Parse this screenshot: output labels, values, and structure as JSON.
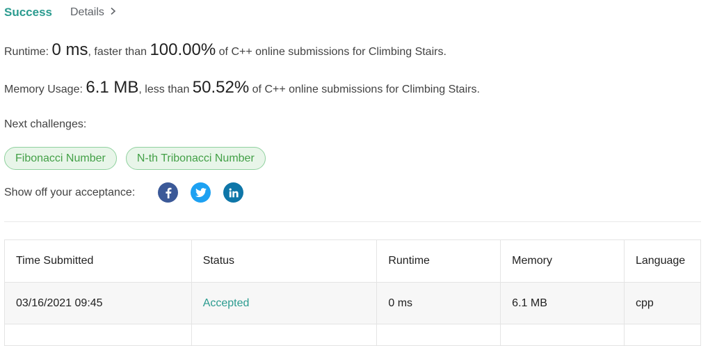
{
  "header": {
    "success_label": "Success",
    "details_label": "Details",
    "details_chevron": "chevron-right-icon"
  },
  "runtime": {
    "label": "Runtime:",
    "value": "0 ms",
    "middle": ", faster than",
    "percent": "100.00%",
    "suffix": "of C++ online submissions for Climbing Stairs."
  },
  "memory": {
    "label": "Memory Usage:",
    "value": "6.1 MB",
    "middle": ", less than",
    "percent": "50.52%",
    "suffix": "of C++ online submissions for Climbing Stairs."
  },
  "next_challenges": {
    "label": "Next challenges:",
    "items": [
      "Fibonacci Number",
      "N-th Tribonacci Number"
    ]
  },
  "share": {
    "label": "Show off your acceptance:",
    "icons": [
      "facebook-icon",
      "twitter-icon",
      "linkedin-icon"
    ]
  },
  "table": {
    "columns": [
      "Time Submitted",
      "Status",
      "Runtime",
      "Memory",
      "Language"
    ],
    "rows": [
      [
        "03/16/2021 09:45",
        "Accepted",
        "0 ms",
        "6.1 MB",
        "cpp"
      ]
    ]
  },
  "colors": {
    "success": "#2b9b8f",
    "chip_border": "#8fd19e",
    "chip_bg": "#e8f5e9",
    "chip_text": "#43a047",
    "facebook": "#3b5998",
    "twitter": "#1da1f2",
    "linkedin": "#0e76a8"
  }
}
